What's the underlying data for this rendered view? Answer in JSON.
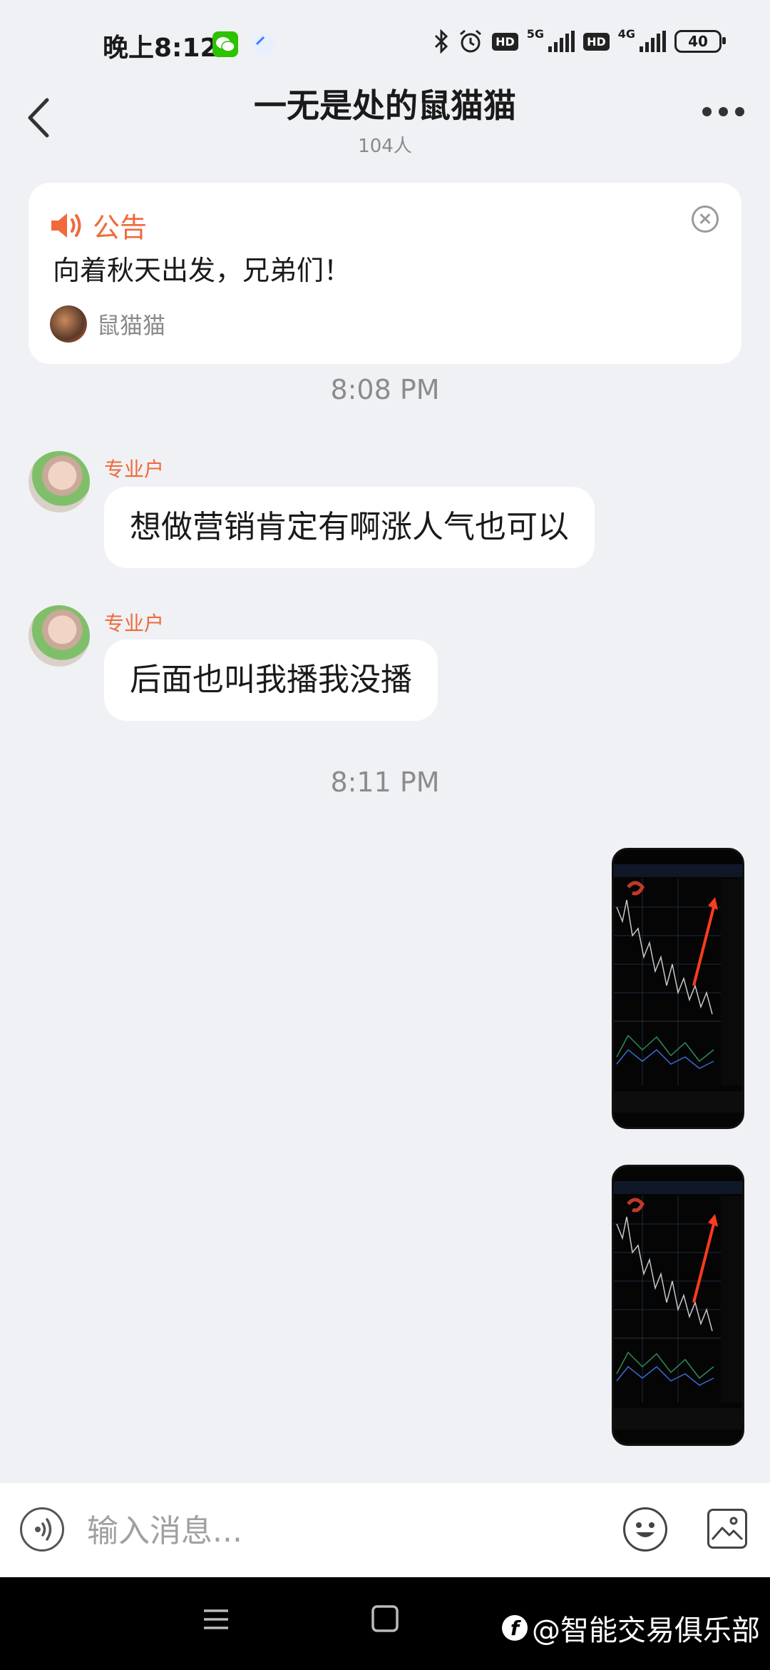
{
  "status_bar": {
    "time": "晚上8:12",
    "network_1": "5G",
    "network_2": "4G",
    "hd": "HD",
    "battery": "40",
    "icons": [
      "wechat-icon",
      "compass-icon",
      "bluetooth-icon",
      "alarm-icon"
    ]
  },
  "header": {
    "title": "一无是处的鼠猫猫",
    "member_count": "104人"
  },
  "announcement": {
    "label": "公告",
    "text": "向着秋天出发，兄弟们！",
    "author": "鼠猫猫"
  },
  "messages": [
    {
      "type": "time",
      "text": "8:08 PM"
    },
    {
      "type": "text",
      "sender": "专业户",
      "text": "想做营销肯定有啊涨人气也可以"
    },
    {
      "type": "text",
      "sender": "专业户",
      "text": "后面也叫我播我没播"
    },
    {
      "type": "time",
      "text": "8:11 PM"
    },
    {
      "type": "image",
      "own": true,
      "description": "chart-screenshot"
    },
    {
      "type": "image",
      "own": true,
      "description": "chart-screenshot"
    }
  ],
  "input": {
    "placeholder": "输入消息..."
  },
  "watermark": {
    "text": "@智能交易俱乐部"
  },
  "colors": {
    "accent": "#f0693a",
    "background": "#f0f1f4"
  }
}
